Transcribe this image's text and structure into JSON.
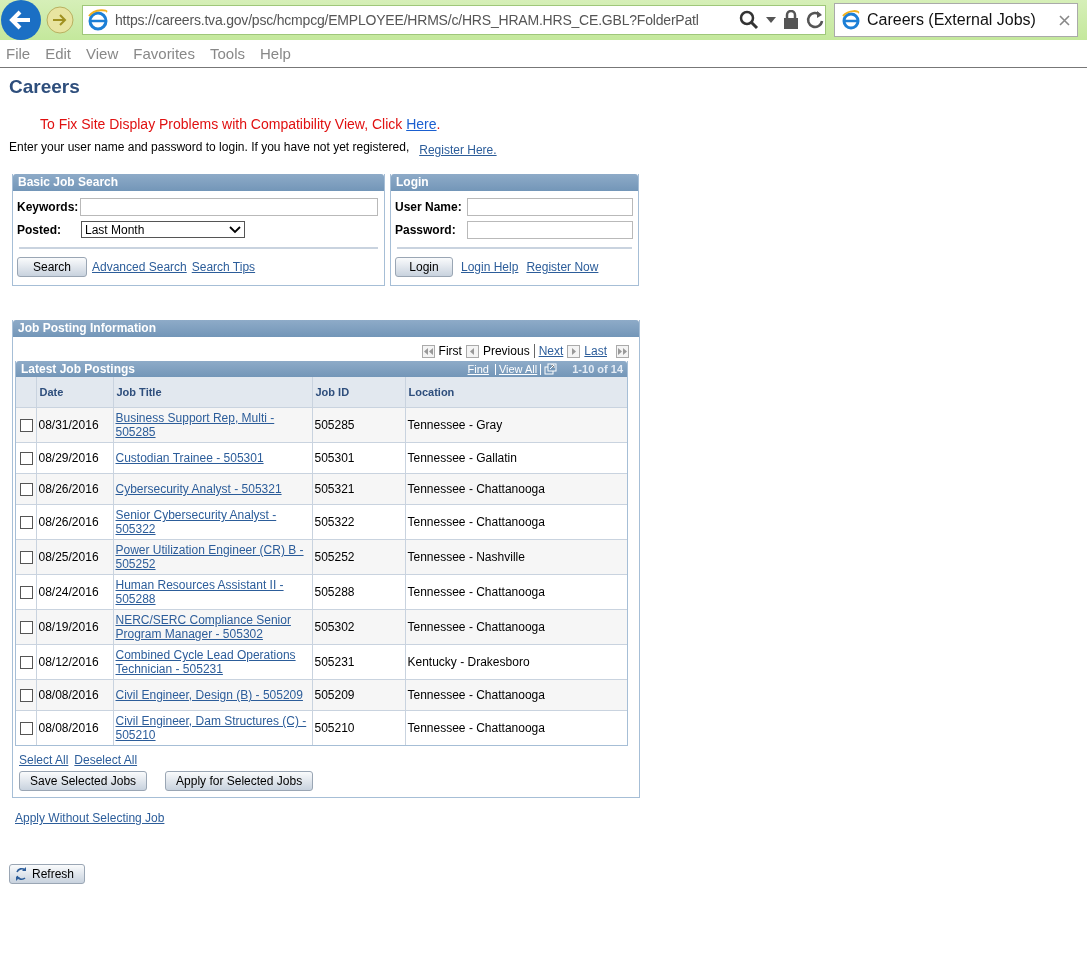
{
  "browser": {
    "address": "https://careers.tva.gov/psc/hcmpcg/EMPLOYEE/HRMS/c/HRS_HRAM.HRS_CE.GBL?FolderPatl",
    "tab_title": "Careers (External Jobs)"
  },
  "menu": [
    "File",
    "Edit",
    "View",
    "Favorites",
    "Tools",
    "Help"
  ],
  "page_title": "Careers",
  "compat_notice": {
    "text": "To Fix Site Display Problems with Compatibility View, Click",
    "link": "Here",
    "end": "."
  },
  "intro": {
    "text": "Enter your user name and password to login. If you have not yet registered,",
    "link": "Register Here."
  },
  "search_panel": {
    "title": "Basic Job Search",
    "keywords_label": "Keywords:",
    "posted_label": "Posted:",
    "posted_value": "Last Month",
    "search_button": "Search",
    "links": [
      "Advanced Search",
      "Search Tips"
    ]
  },
  "login_panel": {
    "title": "Login",
    "user_label": "User Name:",
    "password_label": "Password:",
    "login_button": "Login",
    "links": [
      "Login Help",
      "Register Now"
    ]
  },
  "job_panel": {
    "title": "Job Posting Information",
    "pager": {
      "first": "First",
      "previous": "Previous",
      "next": "Next",
      "last": "Last"
    },
    "grid": {
      "title": "Latest Job Postings",
      "find": "Find",
      "view_all": "View All",
      "count": "1-10 of 14",
      "columns": [
        "Date",
        "Job Title",
        "Job ID",
        "Location"
      ],
      "rows": [
        {
          "checked": false,
          "date": "08/31/2016",
          "title": "Business Support Rep, Multi - 505285",
          "job_id": "505285",
          "location": "Tennessee - Gray"
        },
        {
          "checked": false,
          "date": "08/29/2016",
          "title": "Custodian Trainee - 505301",
          "job_id": "505301",
          "location": "Tennessee - Gallatin"
        },
        {
          "checked": false,
          "date": "08/26/2016",
          "title": "Cybersecurity Analyst - 505321",
          "job_id": "505321",
          "location": "Tennessee - Chattanooga"
        },
        {
          "checked": false,
          "date": "08/26/2016",
          "title": "Senior Cybersecurity Analyst - 505322",
          "job_id": "505322",
          "location": "Tennessee - Chattanooga"
        },
        {
          "checked": false,
          "date": "08/25/2016",
          "title": "Power Utilization Engineer (CR) B - 505252",
          "job_id": "505252",
          "location": "Tennessee - Nashville"
        },
        {
          "checked": false,
          "date": "08/24/2016",
          "title": "Human Resources Assistant II - 505288",
          "job_id": "505288",
          "location": "Tennessee - Chattanooga"
        },
        {
          "checked": false,
          "date": "08/19/2016",
          "title": "NERC/SERC Compliance Senior Program Manager - 505302",
          "job_id": "505302",
          "location": "Tennessee - Chattanooga"
        },
        {
          "checked": false,
          "date": "08/12/2016",
          "title": "Combined Cycle Lead Operations Technician - 505231",
          "job_id": "505231",
          "location": "Kentucky - Drakesboro"
        },
        {
          "checked": false,
          "date": "08/08/2016",
          "title": "Civil Engineer, Design (B) - 505209",
          "job_id": "505209",
          "location": "Tennessee - Chattanooga"
        },
        {
          "checked": false,
          "date": "08/08/2016",
          "title": "Civil Engineer, Dam Structures (C) - 505210",
          "job_id": "505210",
          "location": "Tennessee - Chattanooga"
        }
      ]
    },
    "select_all": "Select All",
    "deselect_all": "Deselect All",
    "save_button": "Save Selected Jobs",
    "apply_button": "Apply for Selected Jobs"
  },
  "apply_without": "Apply Without Selecting Job",
  "refresh_button": "Refresh"
}
